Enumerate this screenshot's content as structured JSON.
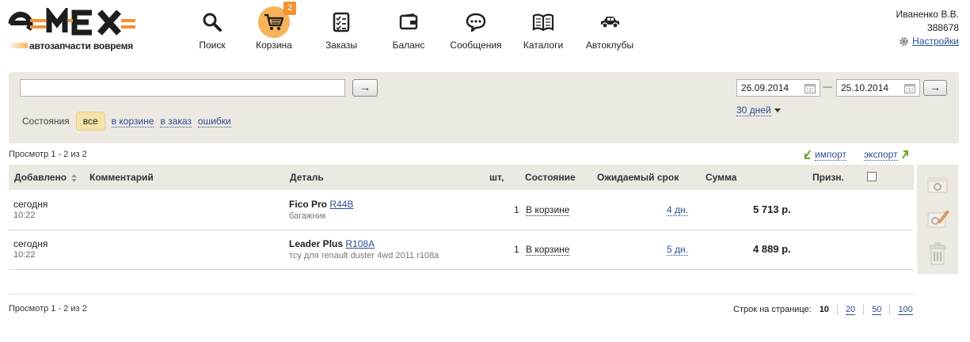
{
  "header": {
    "logo_tagline": "автозапчасти вовремя",
    "nav": [
      {
        "label": "Поиск",
        "icon": "search-icon"
      },
      {
        "label": "Корзина",
        "icon": "cart-icon",
        "badge": "2",
        "active": true
      },
      {
        "label": "Заказы",
        "icon": "orders-icon"
      },
      {
        "label": "Баланс",
        "icon": "wallet-icon"
      },
      {
        "label": "Сообщения",
        "icon": "message-icon"
      },
      {
        "label": "Каталоги",
        "icon": "book-icon"
      },
      {
        "label": "Автоклубы",
        "icon": "car-icon"
      }
    ],
    "user_name": "Иваненко В.В.",
    "user_id": "388678",
    "settings_label": "Настройки"
  },
  "filter": {
    "search_value": "",
    "go_label": "→",
    "date_from": "26.09.2014",
    "date_sep": "—",
    "date_to": "25.10.2014",
    "period_label": "30 дней",
    "states_label": "Состояния",
    "states": [
      "все",
      "в корзине",
      "в заказ",
      "ошибки"
    ]
  },
  "table": {
    "view_count": "Просмотр 1 - 2 из 2",
    "import_label": "импорт",
    "export_label": "экспорт",
    "headers": {
      "added": "Добавлено",
      "comment": "Комментарий",
      "detail": "Деталь",
      "qty": "шт,",
      "state": "Состояние",
      "term": "Ожидаемый срок",
      "sum": "Сумма",
      "sign": "Призн."
    },
    "rows": [
      {
        "date": "сегодня",
        "time": "10:22",
        "brand": "Fico Pro",
        "part": "R44B",
        "desc": "багажник",
        "qty": "1",
        "state": "В корзине",
        "term": "4 дн.",
        "sum": "5 713 р."
      },
      {
        "date": "сегодня",
        "time": "10:22",
        "brand": "Leader Plus",
        "part": "R108A",
        "desc": "тсу для renault duster 4wd 2011 r108a",
        "qty": "1",
        "state": "В корзине",
        "term": "5 дн.",
        "sum": "4 889 р."
      }
    ]
  },
  "footer": {
    "view_count": "Просмотр 1 - 2 из 2",
    "rows_per_page_label": "Строк на странице:",
    "page_sizes": [
      "10",
      "20",
      "50",
      "100"
    ],
    "current_page_size": "10"
  },
  "colors": {
    "accent": "#f39431",
    "panel": "#ece8e2",
    "link": "#2a4f8f",
    "chip": "#f6e3a9"
  }
}
